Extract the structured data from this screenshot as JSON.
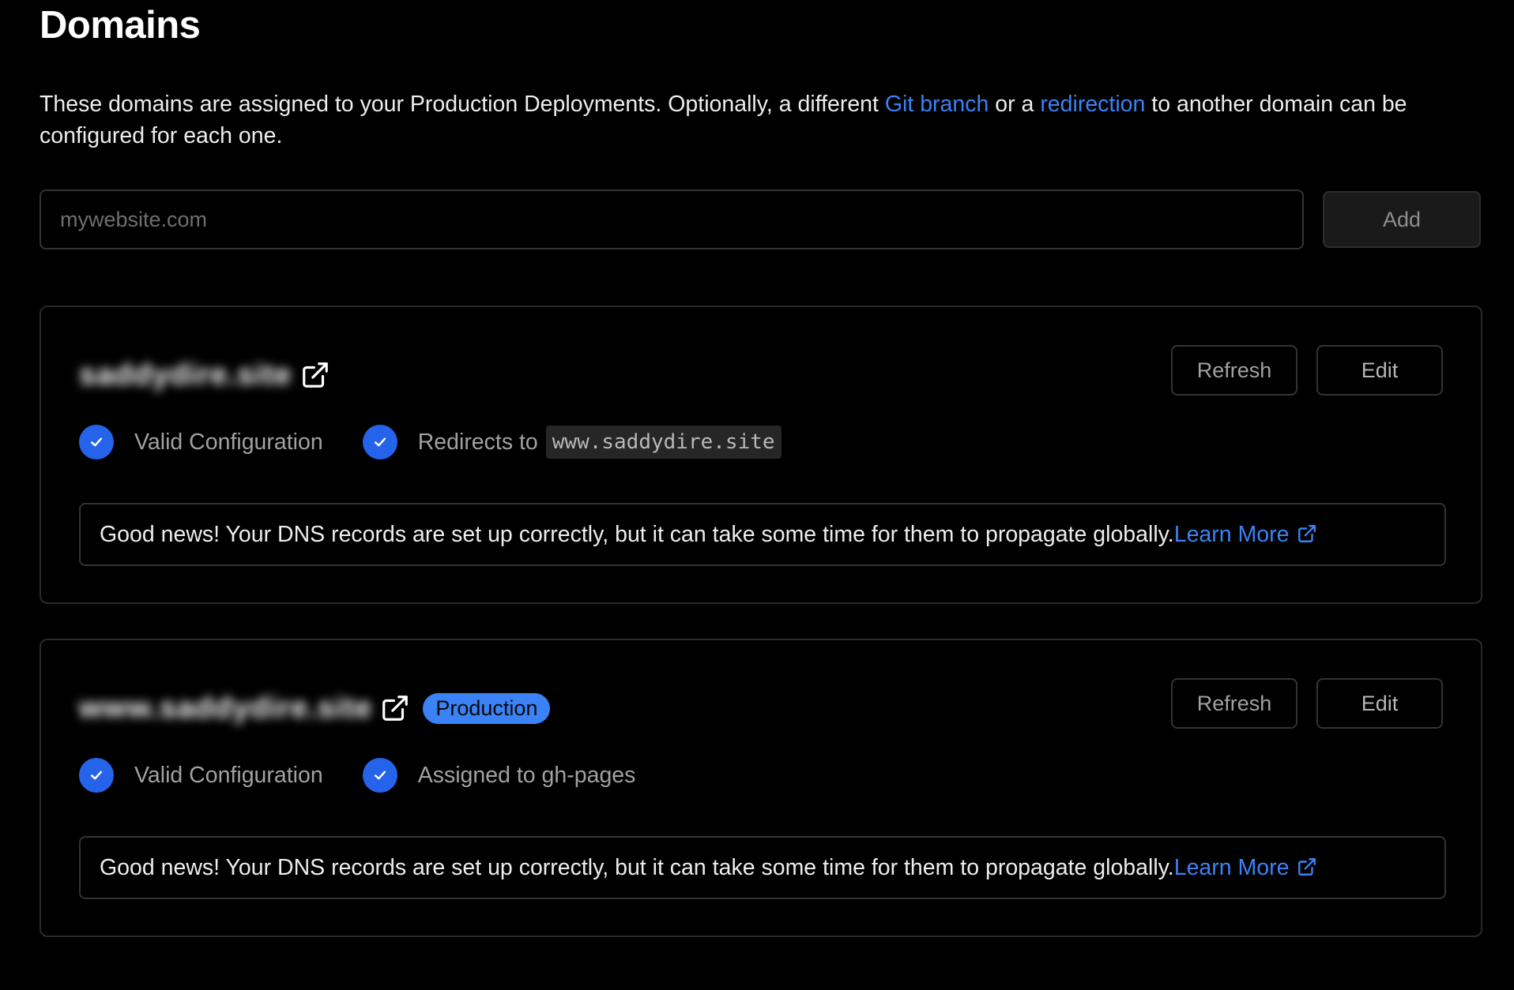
{
  "page": {
    "title": "Domains",
    "description_part1": "These domains are assigned to your Production Deployments. Optionally, a different ",
    "git_branch_link": "Git branch",
    "description_part2": " or a ",
    "redirection_link": "redirection",
    "description_part3": " to another domain can be configured for each one."
  },
  "add_form": {
    "placeholder": "mywebsite.com",
    "value": "",
    "add_label": "Add"
  },
  "colors": {
    "accent": "#3b82f6",
    "background": "#000000",
    "check": "#2563eb"
  },
  "domains": [
    {
      "name": "saddydire.site",
      "name_blurred": true,
      "badge": "",
      "refresh_label": "Refresh",
      "edit_label": "Edit",
      "status1": "Valid Configuration",
      "status2_prefix": "Redirects to ",
      "status2_code": "www.saddydire.site",
      "notice_text": "Good news! Your DNS records are set up correctly, but it can take some time for them to propagate globally. ",
      "learn_more": "Learn More"
    },
    {
      "name": "www.saddydire.site",
      "name_blurred": true,
      "badge": "Production",
      "refresh_label": "Refresh",
      "edit_label": "Edit",
      "status1": "Valid Configuration",
      "status2_prefix": "Assigned to gh-pages",
      "status2_code": "",
      "notice_text": "Good news! Your DNS records are set up correctly, but it can take some time for them to propagate globally. ",
      "learn_more": "Learn More"
    }
  ]
}
